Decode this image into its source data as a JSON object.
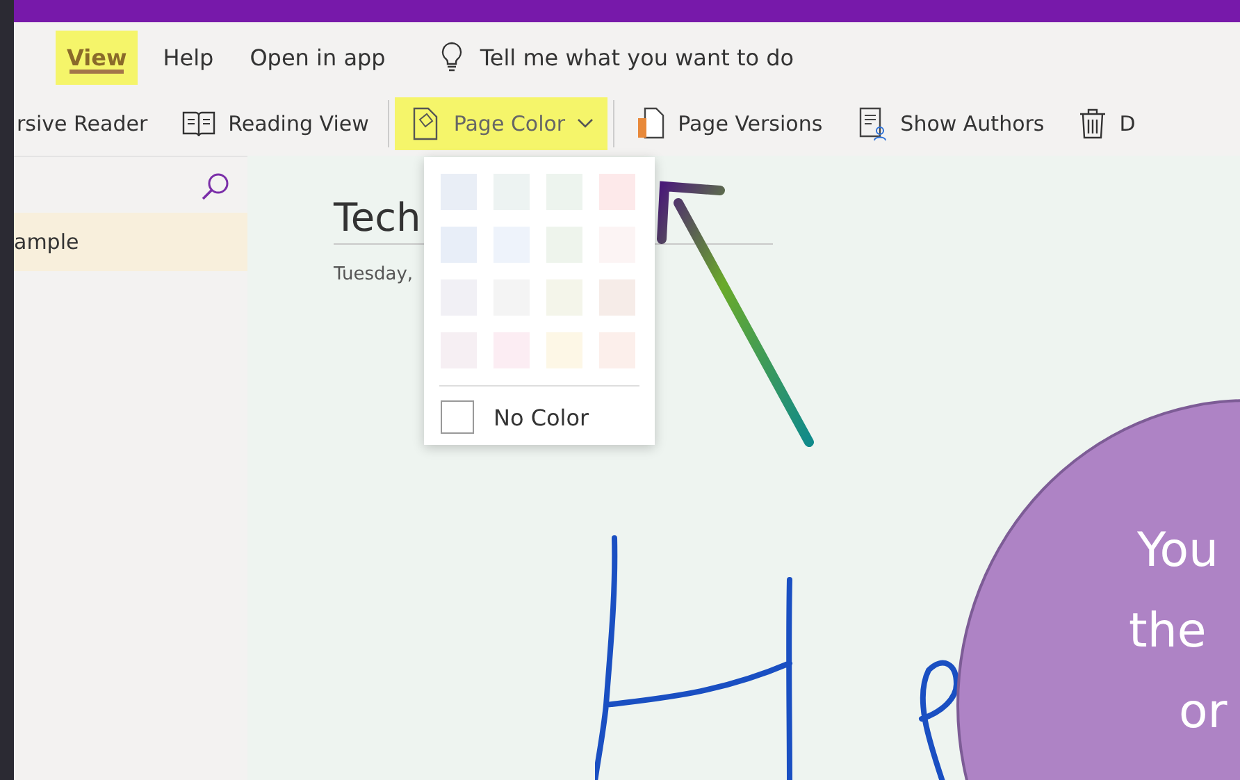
{
  "menu": [
    {
      "label": "View",
      "selected": true,
      "highlighted": true
    },
    {
      "label": "Help",
      "selected": false,
      "highlighted": false
    },
    {
      "label": "Open in app",
      "selected": false,
      "highlighted": false
    }
  ],
  "tell_me": {
    "placeholder": "Tell me what you want to do"
  },
  "toolbar": [
    {
      "kind": "text",
      "label": "rsive Reader",
      "highlighted": false
    },
    {
      "kind": "book",
      "label": "Reading View",
      "highlighted": false
    },
    {
      "kind": "divider"
    },
    {
      "kind": "pagecolor",
      "label": "Page Color",
      "highlighted": true
    },
    {
      "kind": "divider"
    },
    {
      "kind": "versions",
      "label": "Page Versions",
      "highlighted": false
    },
    {
      "kind": "authors",
      "label": "Show Authors",
      "highlighted": false
    },
    {
      "kind": "trash",
      "label": "D",
      "highlighted": false
    }
  ],
  "sidebar": {
    "items": [
      {
        "label": "ample",
        "selected": true
      }
    ]
  },
  "page": {
    "title": "Tech",
    "date": "Tuesday,"
  },
  "page_color_menu": {
    "swatches": [
      {
        "color": "#e9eef6"
      },
      {
        "color": "#edf3f2"
      },
      {
        "color": "#edf4ee"
      },
      {
        "color": "#fde9ea"
      },
      {
        "color": "#e8eef8"
      },
      {
        "color": "#eef3fb"
      },
      {
        "color": "#eef4ec"
      },
      {
        "color": "#fcf4f4"
      },
      {
        "color": "#f1f0f5"
      },
      {
        "color": "#f4f4f4"
      },
      {
        "color": "#f4f5ea"
      },
      {
        "color": "#f6ece8"
      },
      {
        "color": "#f6eff3"
      },
      {
        "color": "#fcedf3"
      },
      {
        "color": "#fdf7e6"
      },
      {
        "color": "#fcefeb"
      }
    ],
    "no_color": "No Color"
  },
  "callout": {
    "lines": [
      "You",
      "the",
      "or"
    ]
  }
}
